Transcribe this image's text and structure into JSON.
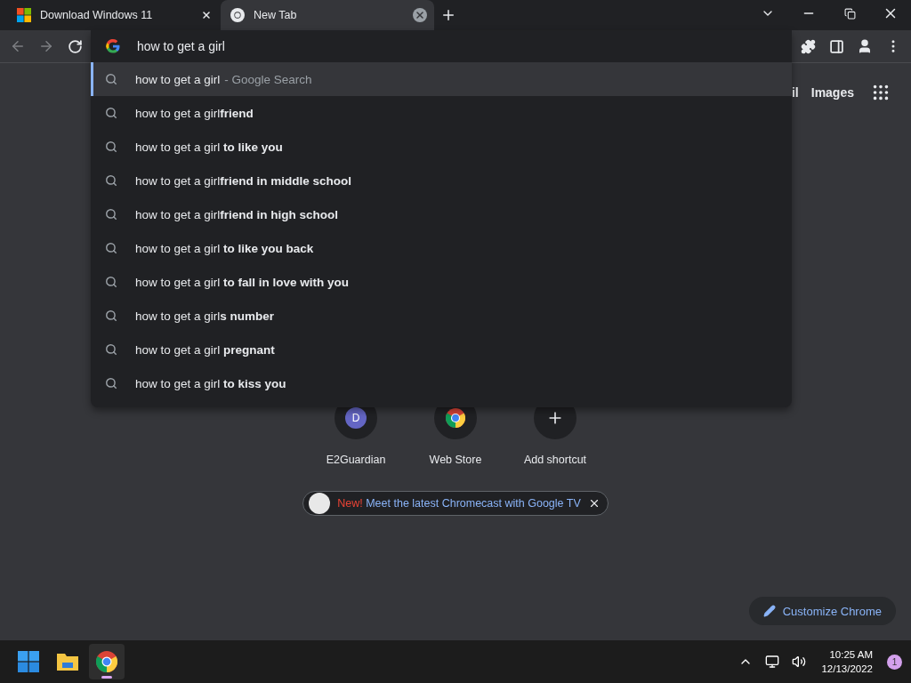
{
  "tabs": [
    {
      "title": "Download Windows 11",
      "kind": "windows",
      "selected": false
    },
    {
      "title": "New Tab",
      "kind": "chrome",
      "selected": true
    }
  ],
  "omnibox": {
    "value": "how to get a girl"
  },
  "suggestions": [
    {
      "text": "how to get a girl",
      "suffix": "- Google Search",
      "selected": true
    },
    {
      "text": "how to get a girl**friend**",
      "selected": false
    },
    {
      "text": "how to get a girl **to like you**",
      "selected": false
    },
    {
      "text": "how to get a girl**friend in middle school**",
      "selected": false
    },
    {
      "text": "how to get a girl**friend in high school**",
      "selected": false
    },
    {
      "text": "how to get a girl **to like you back**",
      "selected": false
    },
    {
      "text": "how to get a girl **to fall in love with you**",
      "selected": false
    },
    {
      "text": "how to get a girl**s number**",
      "selected": false
    },
    {
      "text": "how to get a girl **pregnant**",
      "selected": false
    },
    {
      "text": "how to get a girl **to kiss you**",
      "selected": false
    }
  ],
  "header_links": [
    "il",
    "Images"
  ],
  "shortcuts": [
    {
      "label": "E2Guardian",
      "kind": "letter",
      "letter": "D"
    },
    {
      "label": "Web Store",
      "kind": "store"
    },
    {
      "label": "Add shortcut",
      "kind": "add"
    }
  ],
  "promo": {
    "badge": "New!",
    "text": "Meet the latest Chromecast with Google TV"
  },
  "customize": "Customize Chrome",
  "taskbar": {
    "apps": [
      {
        "kind": "start",
        "selected": false
      },
      {
        "kind": "files",
        "selected": false
      },
      {
        "kind": "chrome",
        "selected": true
      }
    ],
    "time": "10:25 AM",
    "date": "12/13/2022",
    "notifications": "1"
  }
}
